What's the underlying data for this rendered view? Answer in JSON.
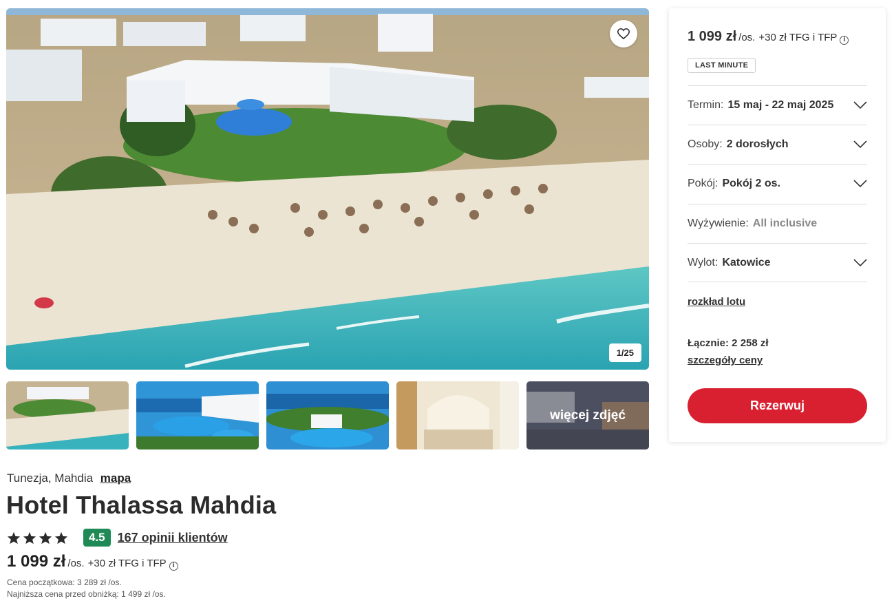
{
  "gallery": {
    "counter": "1/25",
    "more_photos": "więcej zdjęć"
  },
  "hotel": {
    "location": "Tunezja, Mahdia",
    "map_link": "mapa",
    "name": "Hotel Thalassa Mahdia",
    "stars": 4,
    "rating": "4.5",
    "reviews_link": "167 opinii klientów",
    "price": "1 099 zł",
    "price_unit": "/os.",
    "price_extra": "+30 zł TFG i TFP",
    "original_price": "Cena początkowa: 3 289 zł /os.",
    "lowest_price": "Najniższa cena przed obniżką: 1 499 zł /os."
  },
  "booking": {
    "price": "1 099 zł",
    "price_unit": "/os.",
    "price_extra": "+30 zł TFG i TFP",
    "badge": "LAST MINUTE",
    "options": [
      {
        "label": "Termin:",
        "value": "15 maj - 22 maj 2025"
      },
      {
        "label": "Osoby:",
        "value": "2 dorosłych"
      },
      {
        "label": "Pokój:",
        "value": "Pokój 2 os."
      },
      {
        "label": "Wyżywienie:",
        "value": "All inclusive"
      },
      {
        "label": "Wylot:",
        "value": "Katowice"
      }
    ],
    "schedule_link": "rozkład lotu",
    "total": "Łącznie: 2 258 zł",
    "price_details_link": "szczegóły ceny",
    "book_button": "Rezerwuj"
  },
  "colors": {
    "accent_red": "#d92030",
    "rating_green": "#1f8a55"
  }
}
